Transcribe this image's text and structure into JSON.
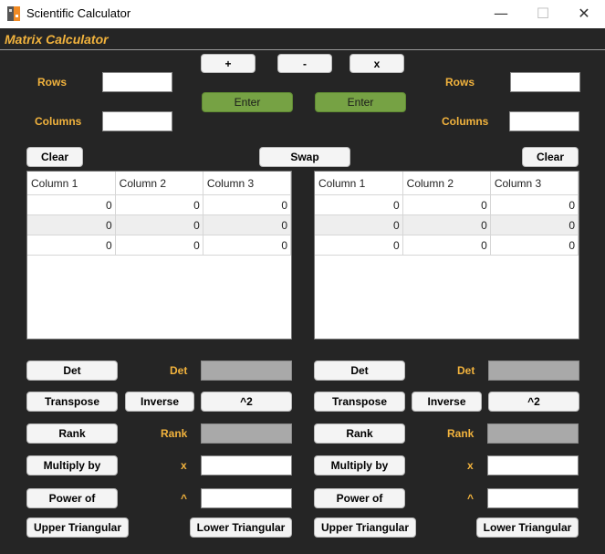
{
  "window": {
    "title": "Scientific Calculator",
    "minimize_glyph": "—",
    "maximize_glyph": "☐",
    "close_glyph": "✕"
  },
  "header": {
    "title": "Matrix Calculator"
  },
  "ops": {
    "add": "+",
    "subtract": "-",
    "multiply": "x",
    "swap": "Swap"
  },
  "left": {
    "rows_label": "Rows",
    "rows_value": "",
    "columns_label": "Columns",
    "columns_value": "",
    "enter": "Enter",
    "clear": "Clear",
    "columns": [
      "Column 1",
      "Column 2",
      "Column 3"
    ],
    "rows": [
      [
        "0",
        "0",
        "0"
      ],
      [
        "0",
        "0",
        "0"
      ],
      [
        "0",
        "0",
        "0"
      ]
    ],
    "det_button": "Det",
    "det_label": "Det",
    "det_value": "",
    "transpose": "Transpose",
    "inverse": "Inverse",
    "square": "^2",
    "rank_button": "Rank",
    "rank_label": "Rank",
    "rank_value": "",
    "multiply_by": "Multiply by",
    "multiply_label": "x",
    "multiply_value": "",
    "power_of": "Power of",
    "power_label": "^",
    "power_value": "",
    "upper": "Upper Triangular",
    "lower": "Lower Triangular"
  },
  "right": {
    "rows_label": "Rows",
    "rows_value": "",
    "columns_label": "Columns",
    "columns_value": "",
    "enter": "Enter",
    "clear": "Clear",
    "columns": [
      "Column 1",
      "Column 2",
      "Column 3"
    ],
    "rows": [
      [
        "0",
        "0",
        "0"
      ],
      [
        "0",
        "0",
        "0"
      ],
      [
        "0",
        "0",
        "0"
      ]
    ],
    "det_button": "Det",
    "det_label": "Det",
    "det_value": "",
    "transpose": "Transpose",
    "inverse": "Inverse",
    "square": "^2",
    "rank_button": "Rank",
    "rank_label": "Rank",
    "rank_value": "",
    "multiply_by": "Multiply by",
    "multiply_label": "x",
    "multiply_value": "",
    "power_of": "Power of",
    "power_label": "^",
    "power_value": "",
    "upper": "Upper Triangular",
    "lower": "Lower Triangular"
  },
  "colors": {
    "accent": "#f2b33d",
    "background": "#252525",
    "enter_green": "#76a244",
    "output_gray": "#a9a9a9"
  }
}
